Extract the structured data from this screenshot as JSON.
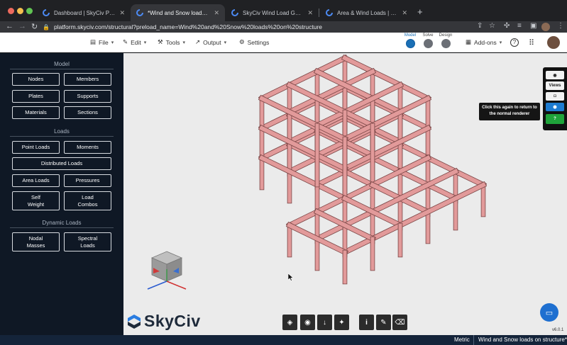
{
  "browser": {
    "tabs": [
      {
        "label": "Dashboard | SkyCiv Platform",
        "active": false
      },
      {
        "label": "*Wind and Snow loads on struc",
        "active": true
      },
      {
        "label": "SkyCiv Wind Load Generator |",
        "active": false
      },
      {
        "label": "Area & Wind Loads | SkyCiv En",
        "active": false
      }
    ],
    "new_tab": "+",
    "url": "platform.skyciv.com/structural?preload_name=Wind%20and%20Snow%20loads%20on%20structure"
  },
  "header": {
    "menus": [
      {
        "label": "File",
        "icon": "file-icon"
      },
      {
        "label": "Edit",
        "icon": "pencil-icon"
      },
      {
        "label": "Tools",
        "icon": "wrench-icon"
      },
      {
        "label": "Output",
        "icon": "output-icon"
      },
      {
        "label": "Settings",
        "icon": "gear-icon"
      }
    ],
    "workflow": [
      "Model",
      "Solve",
      "Design"
    ],
    "addons_label": "Add-ons"
  },
  "sidebar": {
    "model_title": "Model",
    "loads_title": "Loads",
    "dynamic_title": "Dynamic Loads",
    "buttons": {
      "nodes": "Nodes",
      "members": "Members",
      "plates": "Plates",
      "supports": "Supports",
      "materials": "Materials",
      "sections": "Sections",
      "point_loads": "Point Loads",
      "moments": "Moments",
      "distributed_loads": "Distributed Loads",
      "area_loads": "Area Loads",
      "pressures": "Pressures",
      "self_weight_1": "Self",
      "self_weight_2": "Weight",
      "load_combos_1": "Load",
      "load_combos_2": "Combos",
      "nodal_masses_1": "Nodal",
      "nodal_masses_2": "Masses",
      "spectral_loads_1": "Spectral",
      "spectral_loads_2": "Loads"
    }
  },
  "viewport": {
    "right_toolbar_views": "Views",
    "tooltip_line1": "Click this again to return to",
    "tooltip_line2": "the normal renderer",
    "version": "v6.0.1",
    "logo_text": "SkyCiv",
    "member_color": "#e29a9a"
  },
  "status": {
    "units": "Metric",
    "model_name": "Wind and Snow loads on structure*"
  },
  "colors": {
    "accent": "#1a6fb5",
    "sidebar_bg": "#0f1825",
    "status_bg": "#14243a"
  }
}
